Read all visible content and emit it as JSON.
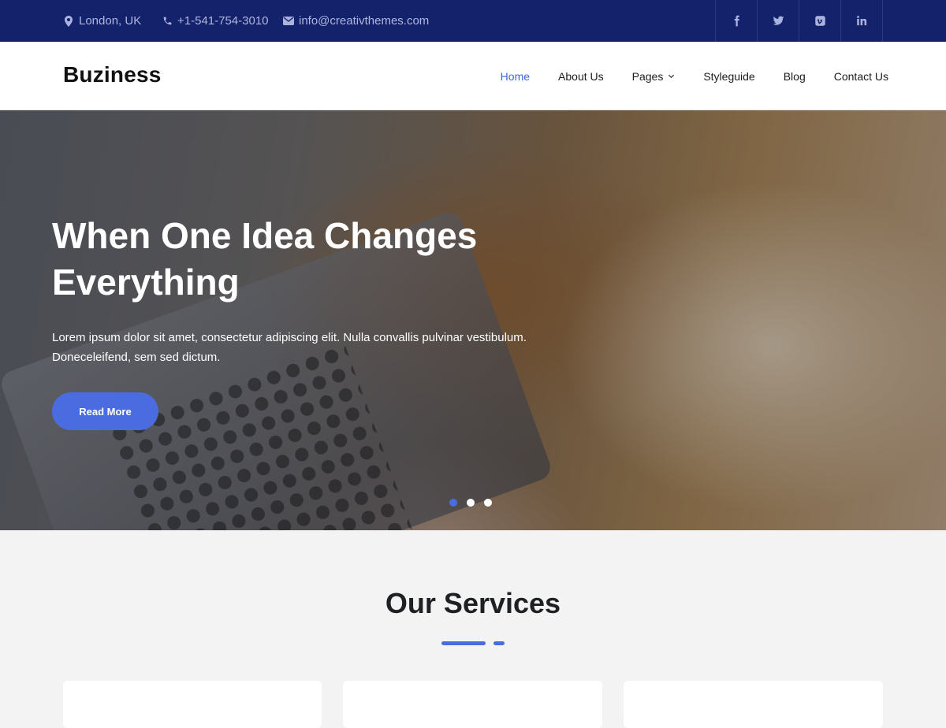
{
  "topbar": {
    "location": "London, UK",
    "phone": "+1-541-754-3010",
    "email": "info@creativthemes.com",
    "social": [
      "facebook-icon",
      "twitter-icon",
      "vimeo-icon",
      "linkedin-icon"
    ]
  },
  "header": {
    "logo": "Buziness",
    "nav": [
      "Home",
      "About Us",
      "Pages",
      "Styleguide",
      "Blog",
      "Contact Us"
    ],
    "active": "Home"
  },
  "hero": {
    "title": "When One Idea Changes Everything",
    "text": "Lorem ipsum dolor sit amet, consectetur adipiscing elit. Nulla convallis pulvinar vestibulum. Doneceleifend, sem sed dictum.",
    "button": "Read More",
    "slides": 3,
    "active_slide": 1
  },
  "services": {
    "title": "Our Services"
  },
  "colors": {
    "topbar": "#14216b",
    "accent": "#4a6ce0",
    "nav_active": "#3c65d9"
  }
}
